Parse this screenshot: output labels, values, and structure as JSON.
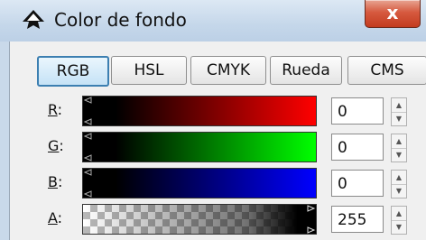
{
  "window": {
    "title": "Color de fondo",
    "close_label": "x"
  },
  "tabs": [
    {
      "label": "RGB",
      "active": true
    },
    {
      "label": "HSL",
      "active": false
    },
    {
      "label": "CMYK",
      "active": false
    },
    {
      "label": "Rueda",
      "active": false
    },
    {
      "label": "CMS",
      "active": false
    }
  ],
  "channels": [
    {
      "label_mnemonic": "R",
      "label_rest": ":",
      "value": "0",
      "end_color": "#ff0000"
    },
    {
      "label_mnemonic": "G",
      "label_rest": ":",
      "value": "0",
      "end_color": "#00ff00"
    },
    {
      "label_mnemonic": "B",
      "label_rest": ":",
      "value": "0",
      "end_color": "#0000ff"
    },
    {
      "label_mnemonic": "A",
      "label_rest": ":",
      "value": "255"
    }
  ],
  "colors": {
    "accent_tab_border": "#3c7fb1",
    "close_button": "#c33b1f"
  }
}
